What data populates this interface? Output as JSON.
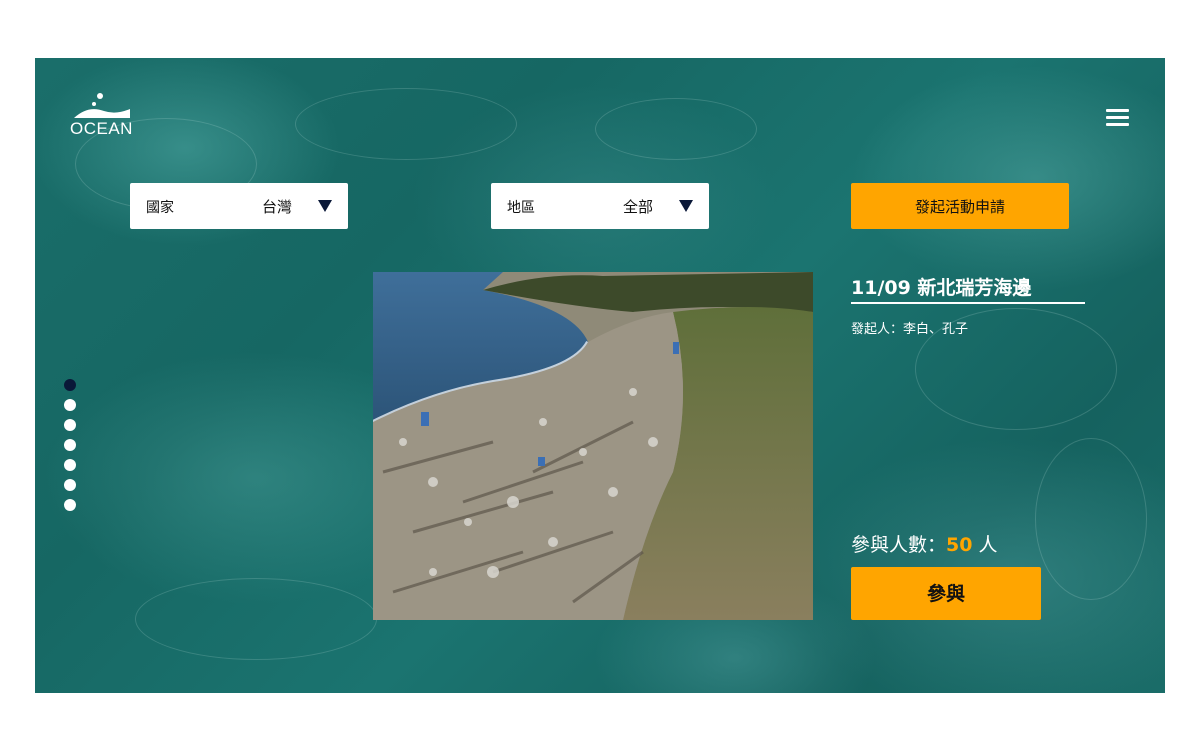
{
  "brand": {
    "logo_text": "OCEAN"
  },
  "filters": {
    "country": {
      "label": "國家",
      "value": "台灣"
    },
    "region": {
      "label": "地區",
      "value": "全部"
    }
  },
  "actions": {
    "apply_label": "發起活動申請",
    "join_label": "參與"
  },
  "event": {
    "title": "11/09 新北瑞芳海邊",
    "organizer": "發起人：李白、孔子",
    "participants_label": "參與人數：",
    "participants_count": "50",
    "participants_unit": " 人"
  },
  "pager": {
    "total": 7,
    "active_index": 0
  },
  "colors": {
    "accent": "#ffa500",
    "ocean": "#1a6e6a",
    "dark": "#0a1838"
  }
}
